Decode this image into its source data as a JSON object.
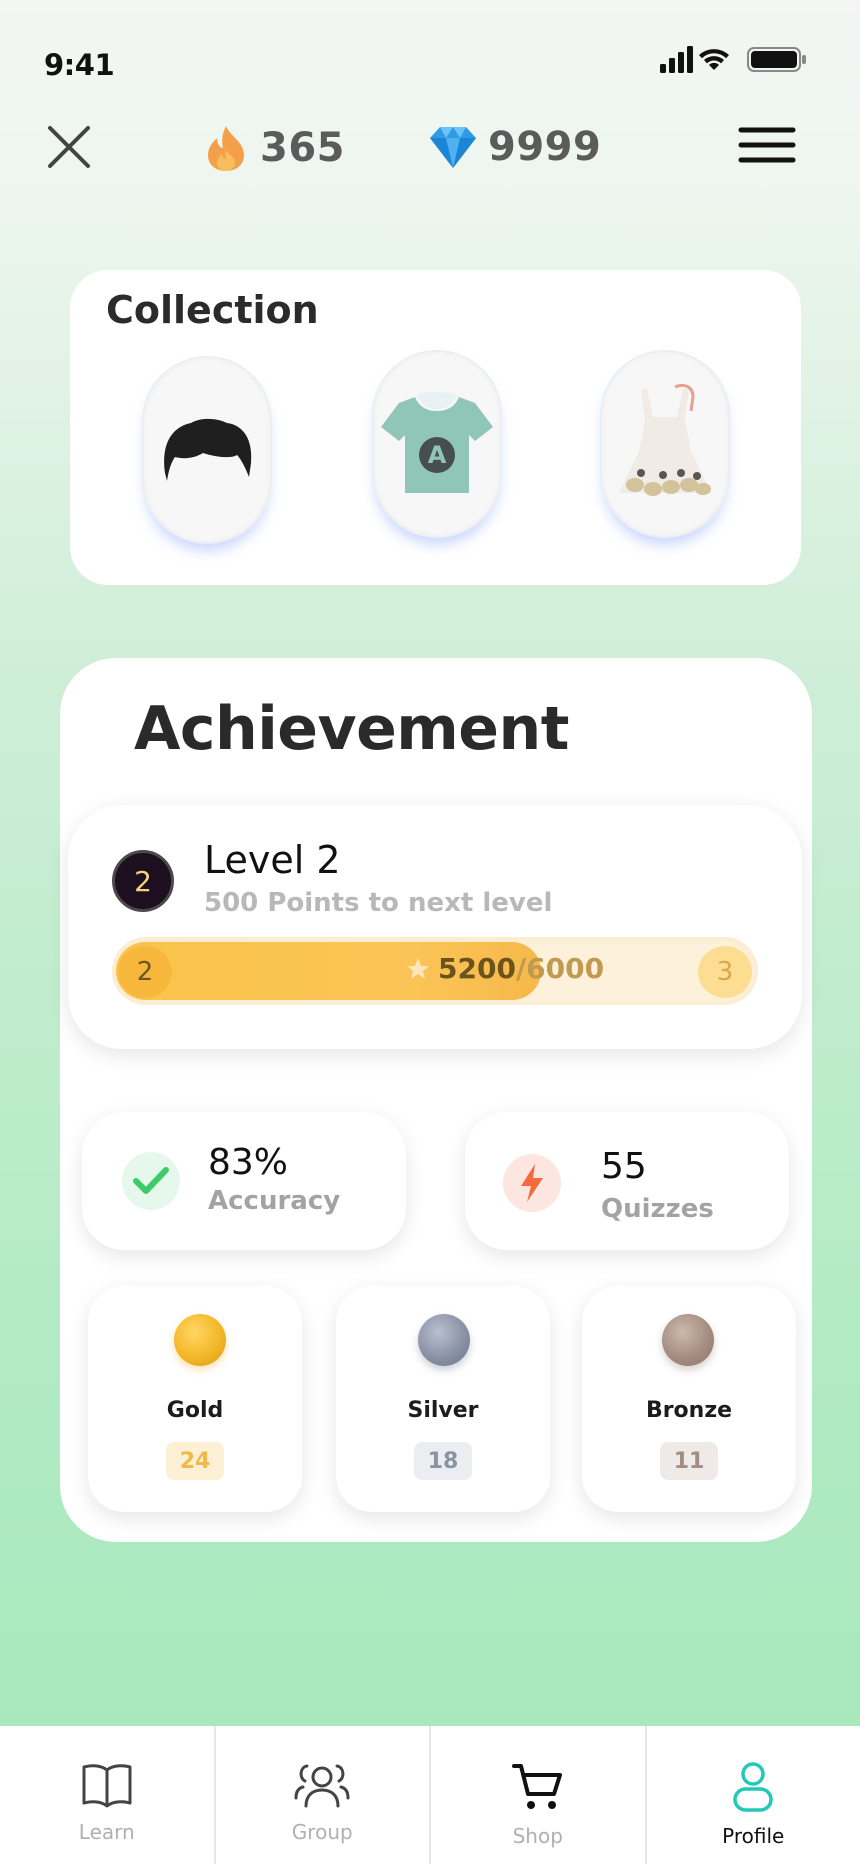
{
  "status_bar": {
    "time": "9:41"
  },
  "top_bar": {
    "streak_count": "365",
    "gem_count": "9999",
    "icons": [
      "close-icon",
      "fire-icon",
      "diamond-icon",
      "menu-icon"
    ]
  },
  "collection": {
    "title": "Collection",
    "items": [
      {
        "name": "hair"
      },
      {
        "name": "t-shirt"
      },
      {
        "name": "dress"
      }
    ],
    "shirt_letter": "A"
  },
  "achievement": {
    "title": "Achievement",
    "level": {
      "badge_number": "2",
      "title": "Level 2",
      "subtitle": "500 Points to next level",
      "start_level": "2",
      "next_level": "3",
      "points_current": "5200",
      "points_max": "/6000",
      "progress_fraction": 0.6667
    },
    "stats": [
      {
        "value": "83%",
        "label": "Accuracy",
        "icon": "check-icon"
      },
      {
        "value": "55",
        "label": "Quizzes",
        "icon": "lightning-icon"
      }
    ],
    "medals": [
      {
        "name": "Gold",
        "count": "24",
        "color": "#f0b525"
      },
      {
        "name": "Silver",
        "count": "18",
        "color": "#8a92a6"
      },
      {
        "name": "Bronze",
        "count": "11",
        "color": "#a58d82"
      }
    ]
  },
  "bottom_nav": {
    "items": [
      {
        "label": "Learn",
        "icon": "book-icon"
      },
      {
        "label": "Group",
        "icon": "group-icon"
      },
      {
        "label": "Shop",
        "icon": "cart-icon"
      },
      {
        "label": "Profile",
        "icon": "profile-icon",
        "active": true
      }
    ],
    "active_color": "#22c9b8"
  }
}
